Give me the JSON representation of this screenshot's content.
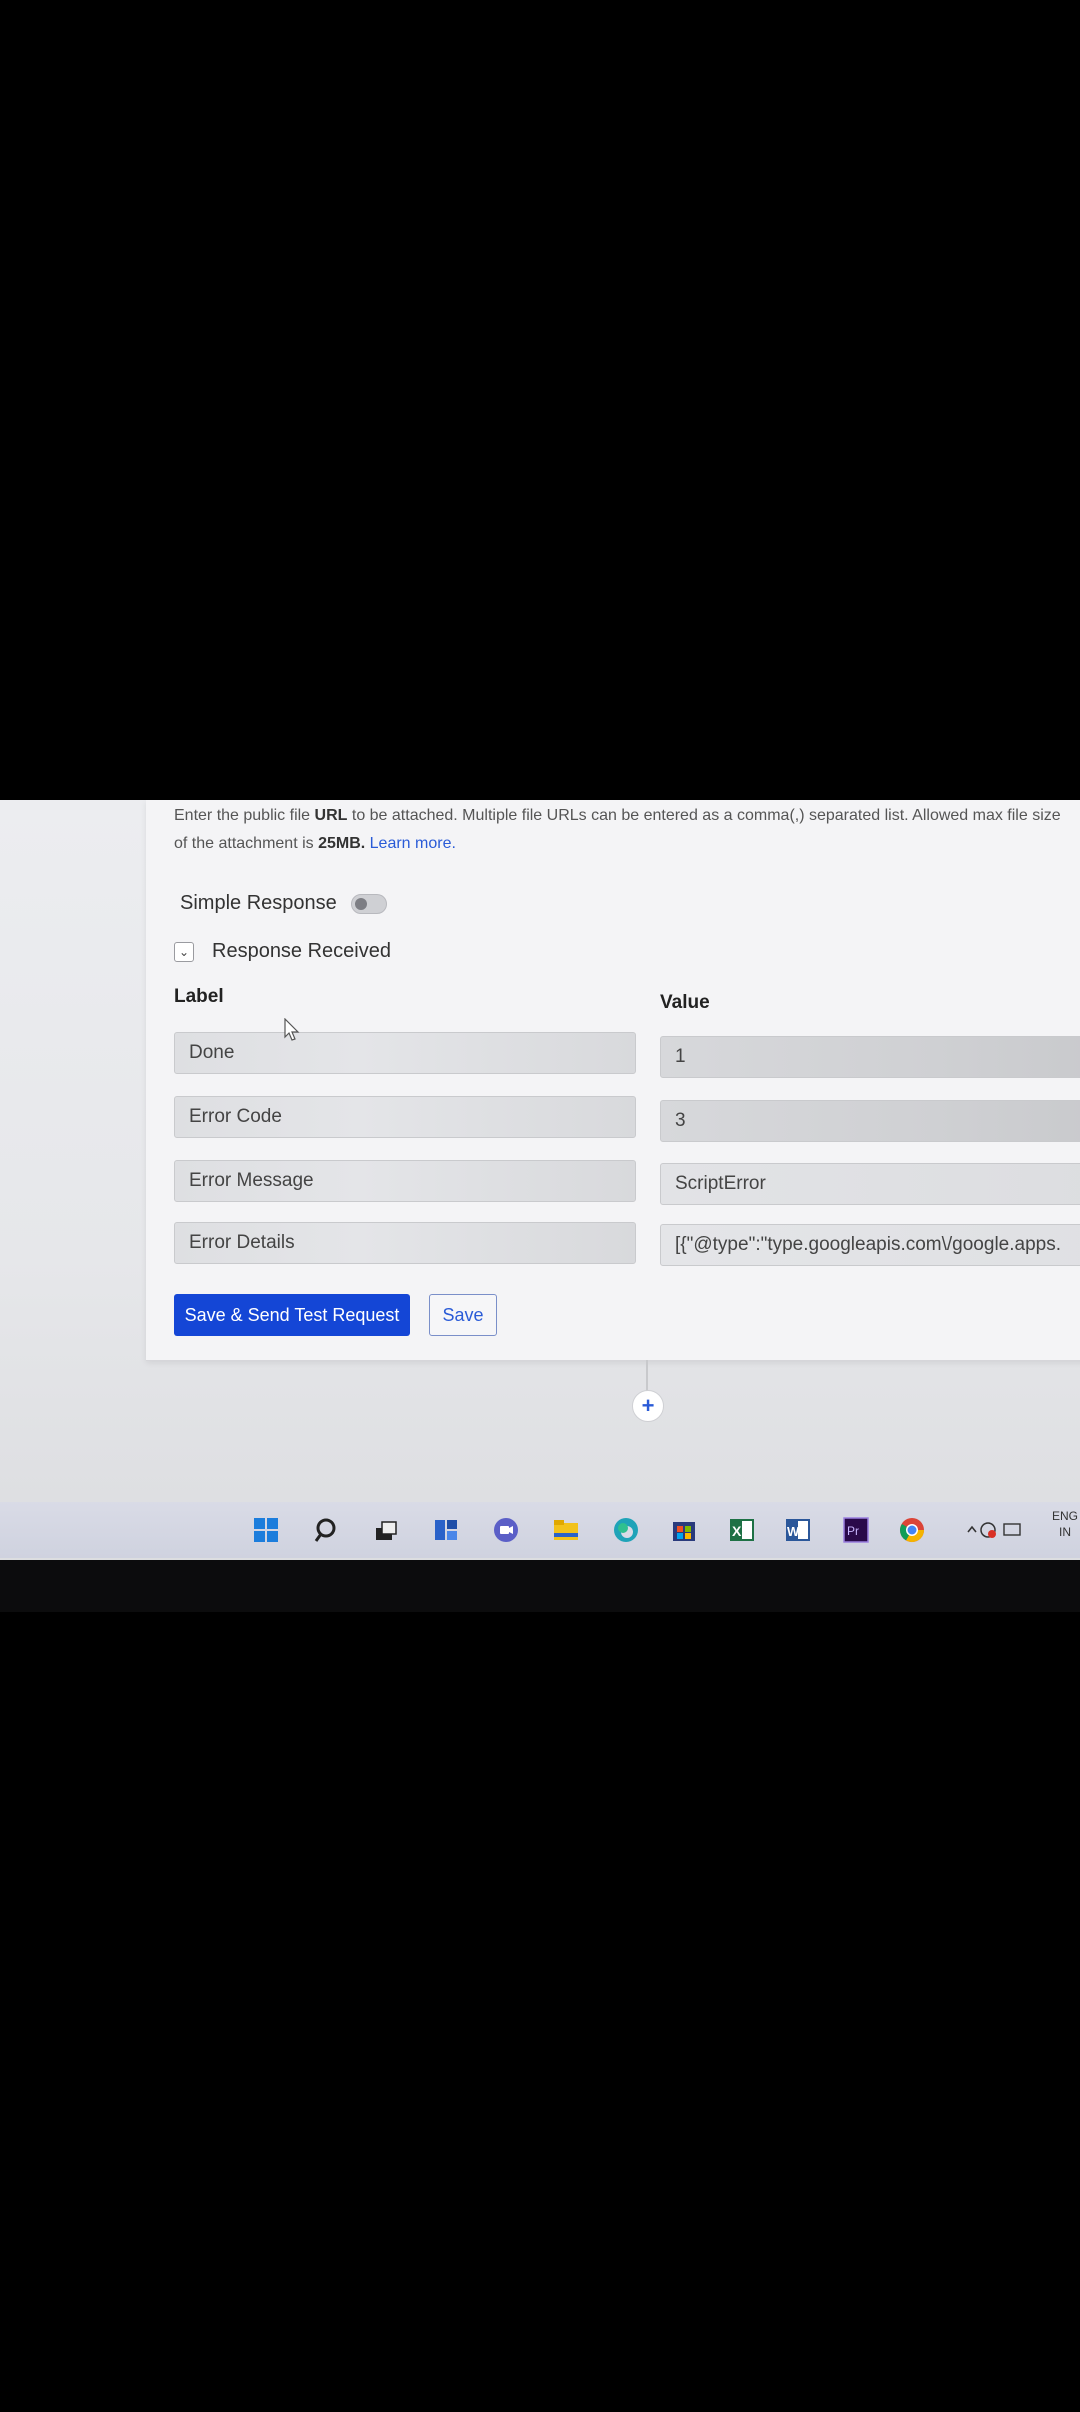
{
  "help": {
    "line1_prefix": "Enter the public file ",
    "line1_bold": "URL",
    "line1_rest": " to be attached. Multiple file URLs can be entered as a comma(,) separated list. Allowed max file size",
    "line2_prefix": "of the attachment is ",
    "line2_bold": "25MB.",
    "learn_more": "Learn more."
  },
  "simple_response": {
    "label": "Simple Response",
    "enabled": false
  },
  "response_received": {
    "label": "Response Received",
    "expanded": true
  },
  "columns": {
    "label": "Label",
    "value": "Value"
  },
  "rows": [
    {
      "label": "Done",
      "value": "1"
    },
    {
      "label": "Error Code",
      "value": "3"
    },
    {
      "label": "Error Message",
      "value": "ScriptError"
    },
    {
      "label": "Error Details",
      "value": "[{\"@type\":\"type.googleapis.com\\/google.apps."
    }
  ],
  "buttons": {
    "save_send": "Save & Send Test Request",
    "save": "Save"
  },
  "add_step": "+",
  "taskbar": {
    "icons": [
      "windows-start-icon",
      "search-icon",
      "task-view-icon",
      "widgets-icon",
      "chat-icon",
      "file-explorer-icon",
      "edge-icon",
      "store-icon",
      "excel-icon",
      "word-icon",
      "premiere-icon",
      "chrome-icon"
    ],
    "tray_lang_line1": "ENG",
    "tray_lang_line2": "IN"
  },
  "colors": {
    "primary": "#1446d6",
    "link": "#2a5bd7"
  }
}
